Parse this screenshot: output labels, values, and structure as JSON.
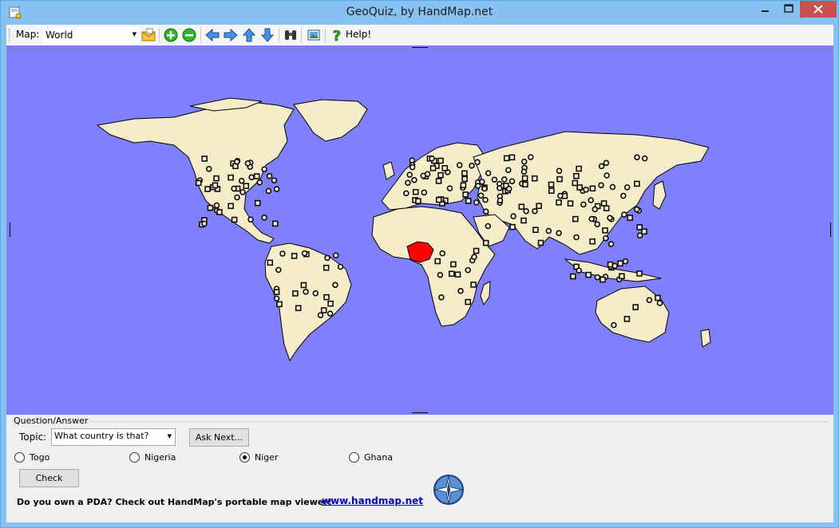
{
  "window": {
    "title": "GeoQuiz, by HandMap.net"
  },
  "toolbar": {
    "map_label": "Map:",
    "map_value": "World",
    "help_label": "Help!",
    "icons": [
      "mail-icon",
      "zoom-in-icon",
      "zoom-out-icon",
      "arrow-left-icon",
      "arrow-right-icon",
      "arrow-up-icon",
      "arrow-down-icon",
      "binoculars-icon",
      "picture-icon",
      "help-icon"
    ]
  },
  "map": {
    "ocean_color": "#8080ff",
    "land_color": "#f5ecc9",
    "highlight_color": "#ff0000",
    "highlighted_country": "Nigeria"
  },
  "qa": {
    "legend": "Question/Answer",
    "topic_label": "Topic:",
    "topic_value": "What country is that?",
    "ask_next": "Ask Next...",
    "options": [
      {
        "label": "Togo",
        "selected": false
      },
      {
        "label": "Nigeria",
        "selected": false
      },
      {
        "label": "Niger",
        "selected": true
      },
      {
        "label": "Ghana",
        "selected": false
      }
    ],
    "check": "Check",
    "pda_text": "Do you own a PDA? Check out HandMap's portable map viewer!",
    "link": "www.handmap.net"
  }
}
